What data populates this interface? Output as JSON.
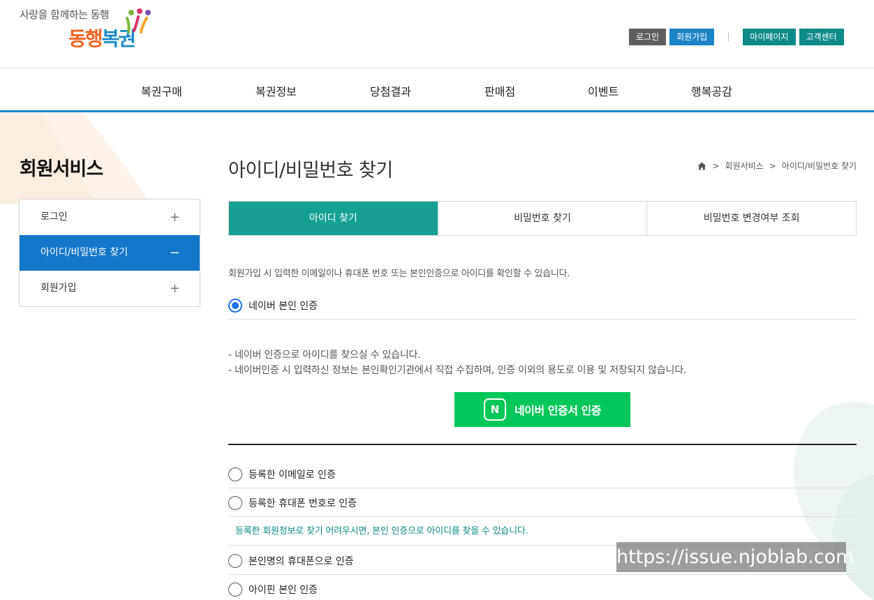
{
  "logo": {
    "tagline": "사랑을 함께하는 동행",
    "name_part1": "동행",
    "name_part2": "복권"
  },
  "util": {
    "login": "로그인",
    "signup": "회원가입",
    "mypage": "마이페이지",
    "support": "고객센터"
  },
  "gnb": [
    "복권구매",
    "복권정보",
    "당첨결과",
    "판매점",
    "이벤트",
    "행복공감"
  ],
  "sidebar": {
    "title": "회원서비스",
    "items": [
      {
        "label": "로그인",
        "sign": "+"
      },
      {
        "label": "아이디/비밀번호 찾기",
        "sign": "−"
      },
      {
        "label": "회원가입",
        "sign": "+"
      }
    ]
  },
  "page": {
    "title": "아이디/비밀번호 찾기",
    "breadcrumb": [
      "회원서비스",
      "아이디/비밀번호 찾기"
    ]
  },
  "tabs": [
    "아이디 찾기",
    "비밀번호 찾기",
    "비밀번호 변경여부 조회"
  ],
  "description": "회원가입 시 입력한 이메일이나 휴대폰 번호 또는 본인인증으로 아이디를 확인할 수 있습니다.",
  "naver": {
    "option_label": "네이버 본인 인증",
    "notes": [
      "- 네이버 인증으로 아이디를 찾으실 수 있습니다.",
      "- 네이버인증 시 입력하신 정보는 본인확인기관에서 직접 수집하며, 인증 이외의 용도로 이용 및 저장되지 않습니다."
    ],
    "button_icon": "N",
    "button_label": "네이버 인증서 인증"
  },
  "options": {
    "email": "등록한 이메일로 인증",
    "phone": "등록한 휴대폰 번호로 인증",
    "info": "등록한 회원정보로 찾기 어려우시면, 본인 인증으로 아이디를 찾을 수 있습니다.",
    "self_phone": "본인명의 휴대폰으로 인증",
    "ipin": "아이핀 본인 인증"
  },
  "watermark": "https://issue.njoblab.com"
}
